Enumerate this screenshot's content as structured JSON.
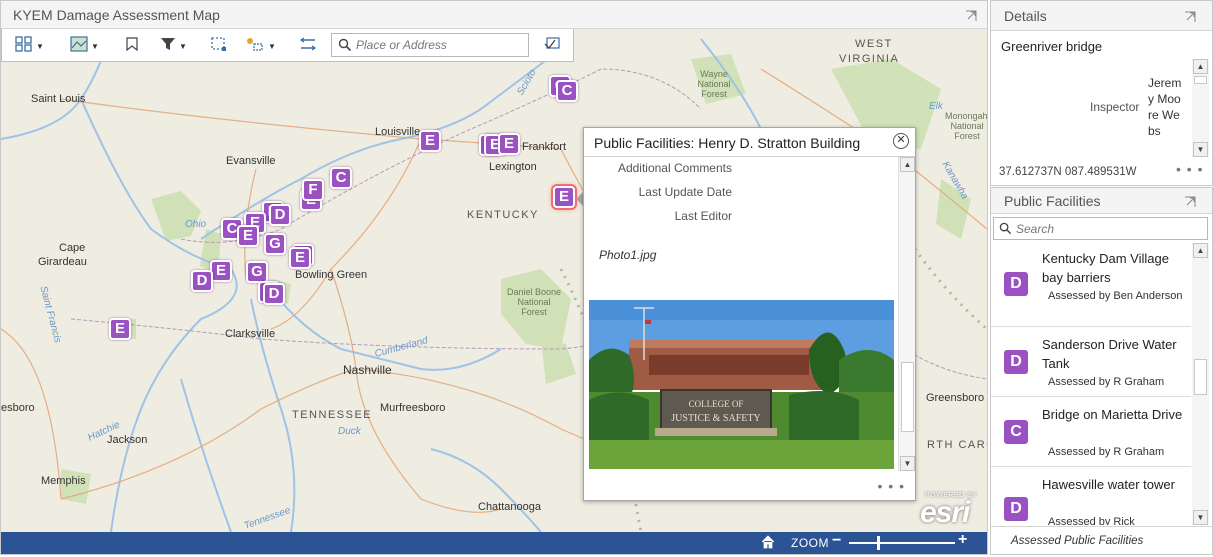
{
  "map": {
    "title": "KYEM Damage Assessment Map",
    "search_placeholder": "Place or Address",
    "labels": {
      "cities": [
        "Saint Louis",
        "Louisville",
        "Frankfort",
        "Lexington",
        "Evansville",
        "Cape",
        "Girardeau",
        "Bowling Green",
        "Clarksville",
        "Nashville",
        "Murfreesboro",
        "Jackson",
        "Memphis",
        "Chattanooga",
        "Greensboro",
        "esboro"
      ],
      "states": [
        "KENTUCKY",
        "TENNESSEE",
        "WEST",
        "VIRGINIA",
        "RTH CARO"
      ],
      "parks": [
        "Wayne National Forest",
        "Daniel Boone National Forest",
        "Monongahela National Forest"
      ],
      "rivers": [
        "Ohio",
        "Cumberland",
        "Duck",
        "Tennessee",
        "Hatchie",
        "Saint Francis",
        "Elk",
        "Kanawha",
        "Scioto"
      ]
    },
    "markers": [
      "C",
      "E",
      "E",
      "E",
      "E",
      "F",
      "C",
      "D",
      "C",
      "E",
      "G",
      "E",
      "D",
      "E",
      "G",
      "D",
      "E"
    ],
    "footer": {
      "zoom_label": "ZOOM",
      "zoom_level": 0.27
    },
    "attribution": {
      "powered_by": "POWERED BY",
      "logo": "esri"
    }
  },
  "popup": {
    "title": "Public Facilities: Henry D. Stratton Building",
    "fields": [
      "Additional Comments",
      "Last Update Date",
      "Last Editor"
    ],
    "attachment": "Photo1.jpg",
    "photo_sign": [
      "COLLEGE OF",
      "JUSTICE & SAFETY"
    ],
    "more": "• • •"
  },
  "details": {
    "title": "Details",
    "name": "Greenriver bridge",
    "inspector_label": "Inspector",
    "inspector_value": "Jeremy Moore Webs",
    "coords": "37.612737N 087.489531W",
    "more": "• • •"
  },
  "public_facilities": {
    "title": "Public Facilities",
    "search_placeholder": "Search",
    "items": [
      {
        "badge": "D",
        "title": "Kentucky Dam Village bay barriers",
        "sub": "Assessed by Ben Anderson"
      },
      {
        "badge": "D",
        "title": "Sanderson Drive Water Tank",
        "sub": "Assessed by R Graham"
      },
      {
        "badge": "C",
        "title": "Bridge on Marietta Drive",
        "sub": "Assessed by R Graham"
      },
      {
        "badge": "D",
        "title": "Hawesville water tower",
        "sub": "Assessed by Rick"
      }
    ],
    "footer": "Assessed Public Facilities"
  },
  "colors": {
    "marker": "#9a52c2",
    "footer_bar": "#2c5494",
    "selection": "#f26d6d"
  }
}
